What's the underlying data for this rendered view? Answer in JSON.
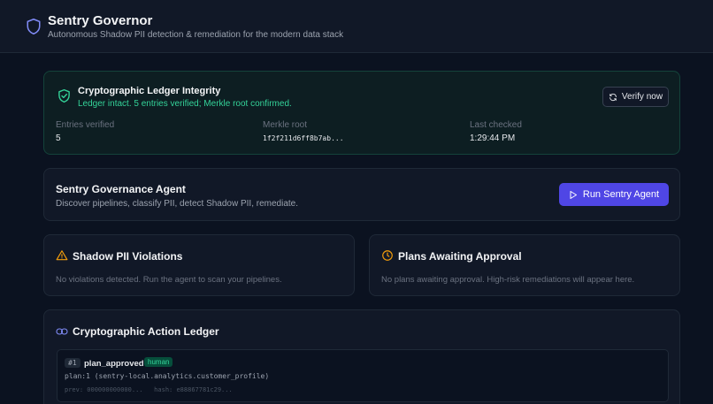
{
  "header": {
    "title": "Sentry Governor",
    "subtitle": "Autonomous Shadow PII detection & remediation for the modern data stack"
  },
  "integrity": {
    "title": "Cryptographic Ledger Integrity",
    "message": "Ledger intact. 5 entries verified; Merkle root confirmed.",
    "verify_label": "Verify now",
    "stats": {
      "entries_label": "Entries verified",
      "entries_value": "5",
      "merkle_label": "Merkle root",
      "merkle_value": "1f2f211d6ff8b7ab...",
      "checked_label": "Last checked",
      "checked_value": "1:29:44 PM"
    }
  },
  "agent": {
    "title": "Sentry Governance Agent",
    "subtitle": "Discover pipelines, classify PII, detect Shadow PII, remediate.",
    "run_label": "Run Sentry Agent"
  },
  "violations": {
    "title": "Shadow PII Violations",
    "empty": "No violations detected. Run the agent to scan your pipelines."
  },
  "plans": {
    "title": "Plans Awaiting Approval",
    "empty": "No plans awaiting approval. High-risk remediations will appear here."
  },
  "ledger": {
    "title": "Cryptographic Action Ledger",
    "entries": [
      {
        "num": "#1",
        "action": "plan_approved",
        "actor": "human",
        "detail": "plan:1 (sentry-local.analytics.customer_profile)",
        "prev": "prev: 000000000000...",
        "hash": "hash: e88867781c29..."
      }
    ]
  },
  "colors": {
    "accent": "#4f46e5",
    "success": "#34d399",
    "warning": "#f59e0b",
    "link": "#818cf8"
  }
}
